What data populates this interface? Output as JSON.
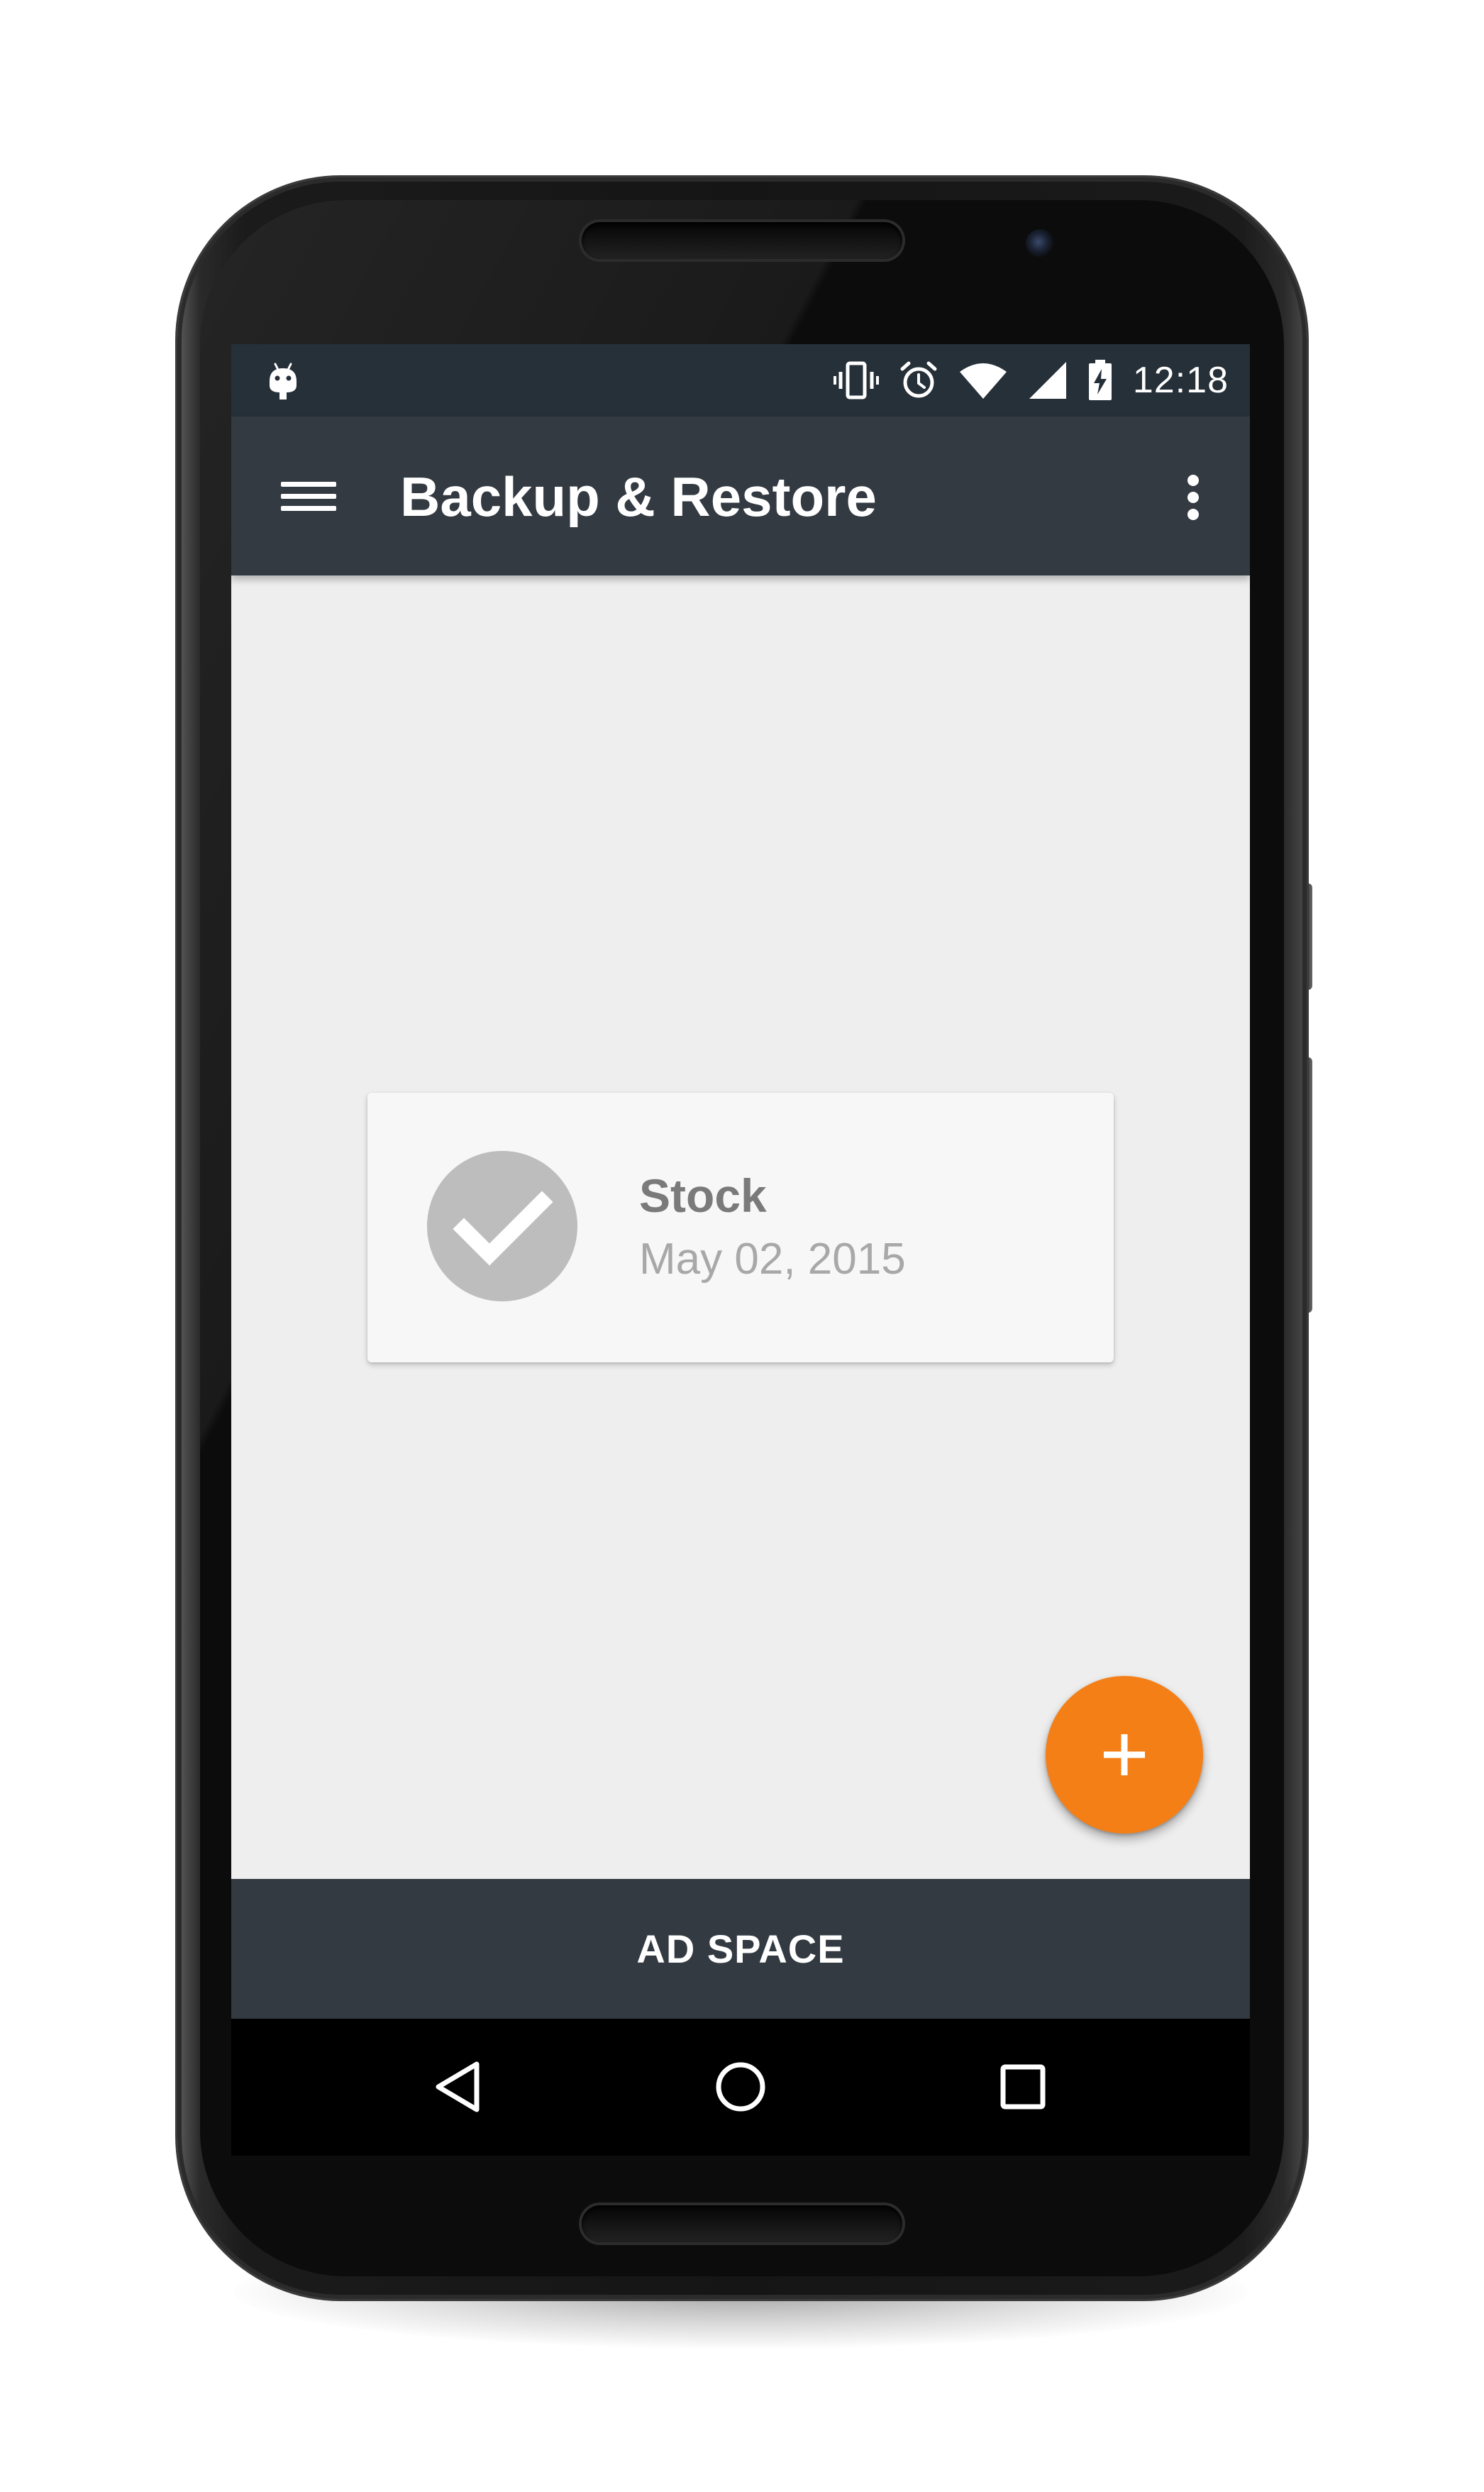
{
  "status_bar": {
    "time": "12:18",
    "left_icon": "android-debug-icon",
    "icons": [
      "vibrate-icon",
      "alarm-icon",
      "wifi-icon",
      "signal-icon",
      "battery-charging-icon"
    ]
  },
  "app_bar": {
    "title": "Backup & Restore",
    "menu_icon": "hamburger-menu-icon",
    "overflow_icon": "more-vert-icon"
  },
  "backups": [
    {
      "name": "Stock",
      "date": "May 02, 2015",
      "icon": "check-circle-icon"
    }
  ],
  "fab": {
    "icon": "plus-icon",
    "color": "#f57f17"
  },
  "ad": {
    "label": "AD SPACE"
  },
  "nav_bar": {
    "icons": [
      "back-icon",
      "home-icon",
      "recents-icon"
    ]
  },
  "colors": {
    "app_bar": "#333a42",
    "status_bar": "#263038",
    "background": "#eeeeee",
    "accent": "#f57f17"
  }
}
